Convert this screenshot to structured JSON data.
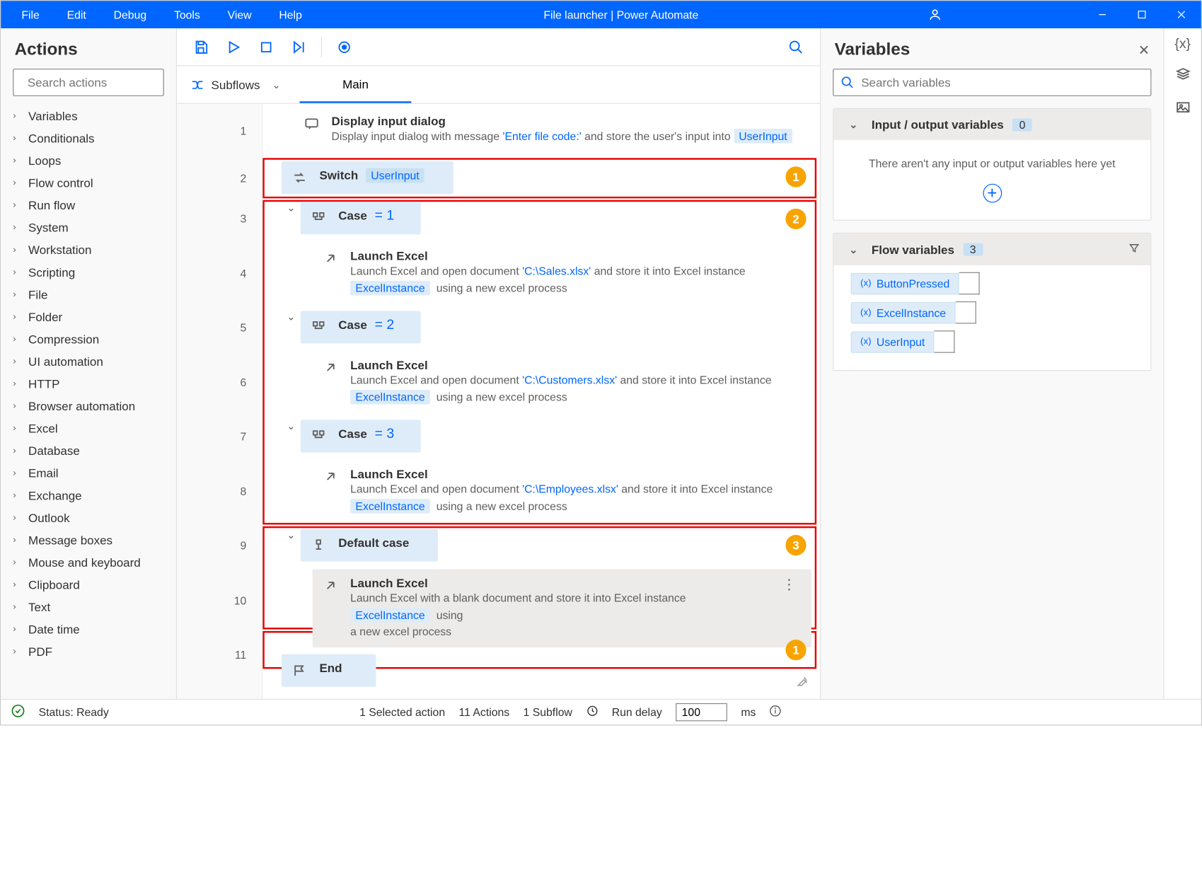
{
  "menus": [
    "File",
    "Edit",
    "Debug",
    "Tools",
    "View",
    "Help"
  ],
  "window_title": "File launcher | Power Automate",
  "actions_panel": {
    "title": "Actions",
    "search_placeholder": "Search actions",
    "categories": [
      "Variables",
      "Conditionals",
      "Loops",
      "Flow control",
      "Run flow",
      "System",
      "Workstation",
      "Scripting",
      "File",
      "Folder",
      "Compression",
      "UI automation",
      "HTTP",
      "Browser automation",
      "Excel",
      "Database",
      "Email",
      "Exchange",
      "Outlook",
      "Message boxes",
      "Mouse and keyboard",
      "Clipboard",
      "Text",
      "Date time",
      "PDF"
    ]
  },
  "subflows_label": "Subflows",
  "main_tab": "Main",
  "steps": [
    {
      "n": 1,
      "type": "dialog",
      "title": "Display input dialog",
      "desc_pre": "Display input dialog with message ",
      "quote": "'Enter file code:'",
      "desc_mid": " and store the user's input into ",
      "var": "UserInput"
    },
    {
      "n": 2,
      "type": "switch",
      "title": "Switch",
      "var": "UserInput"
    },
    {
      "n": 3,
      "type": "case",
      "title": "Case",
      "val": "= 1"
    },
    {
      "n": 4,
      "type": "launch",
      "title": "Launch Excel",
      "desc_pre": "Launch Excel and open document ",
      "quote": "'C:\\Sales.xlsx'",
      "desc_mid": " and store it into Excel instance",
      "var": "ExcelInstance",
      "suffix": "using a new excel process"
    },
    {
      "n": 5,
      "type": "case",
      "title": "Case",
      "val": "= 2"
    },
    {
      "n": 6,
      "type": "launch",
      "title": "Launch Excel",
      "desc_pre": "Launch Excel and open document ",
      "quote": "'C:\\Customers.xlsx'",
      "desc_mid": " and store it into Excel instance",
      "var": "ExcelInstance",
      "suffix": "using a new excel process"
    },
    {
      "n": 7,
      "type": "case",
      "title": "Case",
      "val": "= 3"
    },
    {
      "n": 8,
      "type": "launch",
      "title": "Launch Excel",
      "desc_pre": "Launch Excel and open document ",
      "quote": "'C:\\Employees.xlsx'",
      "desc_mid": " and store it into Excel instance",
      "var": "ExcelInstance",
      "suffix": "using a new excel process"
    },
    {
      "n": 9,
      "type": "default",
      "title": "Default case"
    },
    {
      "n": 10,
      "type": "launch_blank",
      "title": "Launch Excel",
      "desc_pre": "Launch Excel with a blank document and store it into Excel instance ",
      "var": "ExcelInstance",
      "suffix": "using a new excel process",
      "selected": true
    },
    {
      "n": 11,
      "type": "end",
      "title": "End"
    }
  ],
  "vars_panel": {
    "title": "Variables",
    "search_placeholder": "Search variables",
    "io_title": "Input / output variables",
    "io_count": "0",
    "io_empty": "There aren't any input or output variables here yet",
    "flow_title": "Flow variables",
    "flow_count": "3",
    "flow_vars": [
      "ButtonPressed",
      "ExcelInstance",
      "UserInput"
    ]
  },
  "status": {
    "text": "Status: Ready",
    "selected": "1 Selected action",
    "actions": "11 Actions",
    "subflow": "1 Subflow",
    "delay_label": "Run delay",
    "delay_value": "100",
    "delay_unit": "ms"
  }
}
